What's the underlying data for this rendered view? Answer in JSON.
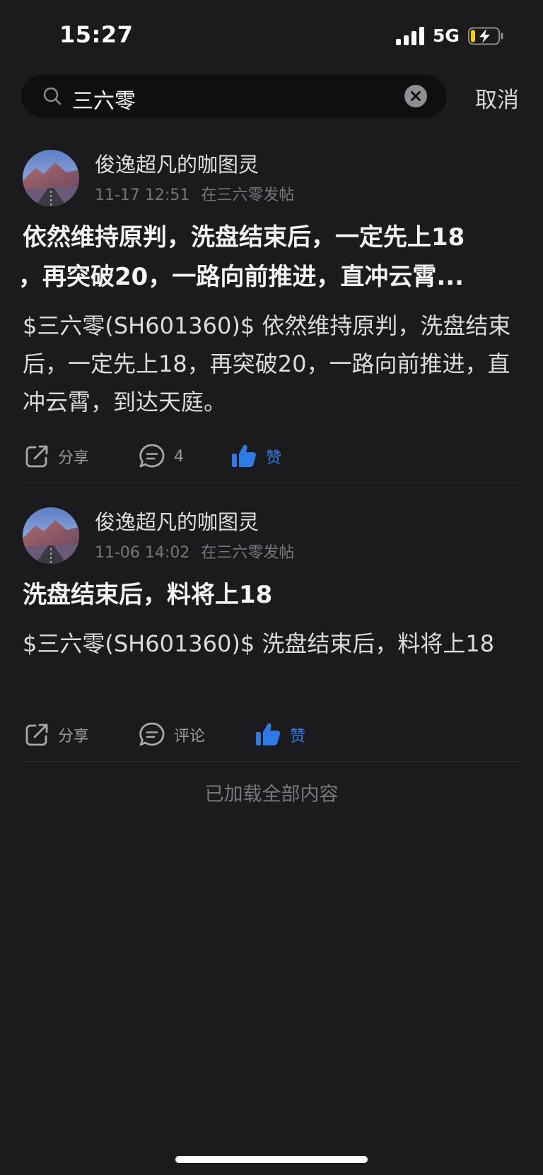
{
  "status_bar": {
    "time": "15:27",
    "network": "5G",
    "icons": [
      "signal-icon",
      "battery-charging-icon"
    ]
  },
  "search": {
    "query": "三六零",
    "cancel_label": "取消",
    "icons": [
      "search-icon",
      "clear-icon"
    ]
  },
  "posts": [
    {
      "author": "俊逸超凡的咖图灵",
      "time": "11-17 12:51",
      "where": "在三六零发帖",
      "title": "依然维持原判，洗盘结束后，一定先上18，再突破20，一路向前推进，直冲云霄...",
      "title_lines": [
        "依然维持原判，洗盘结束后，一定先上18",
        "，再突破20，一路向前推进，直冲云霄..."
      ],
      "body": "$三六零(SH601360)$ 依然维持原判，洗盘结束后，一定先上18，再突破20，一路向前推进，直冲云霄，到达天庭。",
      "actions": {
        "share": "分享",
        "comment": "4",
        "like": "赞"
      }
    },
    {
      "author": "俊逸超凡的咖图灵",
      "time": "11-06 14:02",
      "where": "在三六零发帖",
      "title": "洗盘结束后，料将上18",
      "title_lines": [
        "洗盘结束后，料将上18"
      ],
      "body": "$三六零(SH601360)$ 洗盘结束后，料将上18",
      "actions": {
        "share": "分享",
        "comment": "评论",
        "like": "赞"
      }
    }
  ],
  "footer": {
    "end_text": "已加载全部内容"
  },
  "colors": {
    "background": "#1b1b1d",
    "like_blue": "#2f7be6",
    "muted": "#75757a"
  }
}
